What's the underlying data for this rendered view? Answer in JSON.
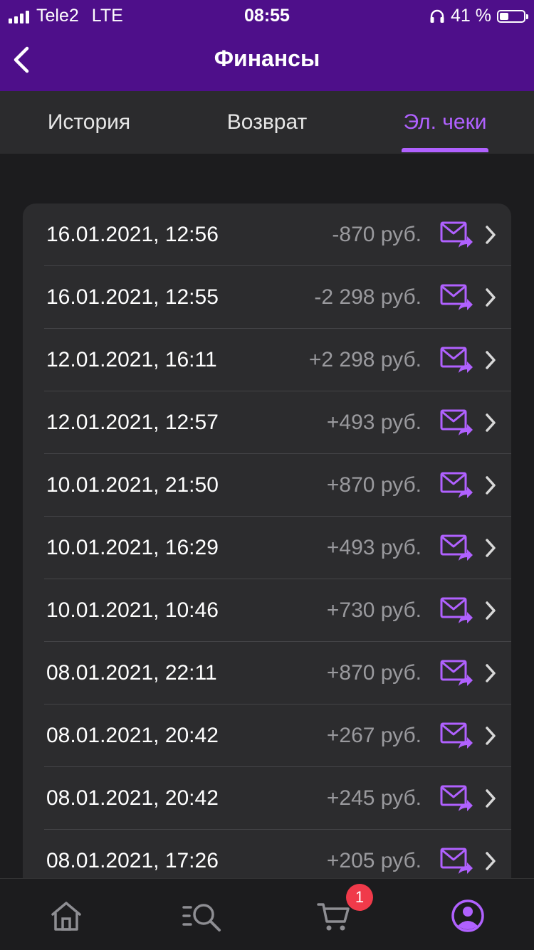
{
  "status_bar": {
    "carrier": "Tele2",
    "network": "LTE",
    "time": "08:55",
    "battery": "41 %",
    "battery_level": 0.41
  },
  "nav": {
    "title": "Финансы"
  },
  "tabs": [
    {
      "label": "История",
      "active": false
    },
    {
      "label": "Возврат",
      "active": false
    },
    {
      "label": "Эл. чеки",
      "active": true
    }
  ],
  "receipts": [
    {
      "datetime": "16.01.2021, 12:56",
      "amount": "-870 руб."
    },
    {
      "datetime": "16.01.2021, 12:55",
      "amount": "-2 298 руб."
    },
    {
      "datetime": "12.01.2021, 16:11",
      "amount": "+2 298 руб."
    },
    {
      "datetime": "12.01.2021, 12:57",
      "amount": "+493 руб."
    },
    {
      "datetime": "10.01.2021, 21:50",
      "amount": "+870 руб."
    },
    {
      "datetime": "10.01.2021, 16:29",
      "amount": "+493 руб."
    },
    {
      "datetime": "10.01.2021, 10:46",
      "amount": "+730 руб."
    },
    {
      "datetime": "08.01.2021, 22:11",
      "amount": "+870 руб."
    },
    {
      "datetime": "08.01.2021, 20:42",
      "amount": "+267 руб."
    },
    {
      "datetime": "08.01.2021, 20:42",
      "amount": "+245 руб."
    },
    {
      "datetime": "08.01.2021, 17:26",
      "amount": "+205 руб."
    }
  ],
  "bottom_nav": {
    "items": [
      "home-icon",
      "catalog-search-icon",
      "cart-icon",
      "profile-icon"
    ],
    "cart_badge": "1",
    "active": "profile-icon"
  },
  "colors": {
    "header": "#4e0f8a",
    "accent": "#b061ff",
    "background": "#1c1c1e",
    "card": "#2c2c2e",
    "badge": "#f03a4a"
  }
}
